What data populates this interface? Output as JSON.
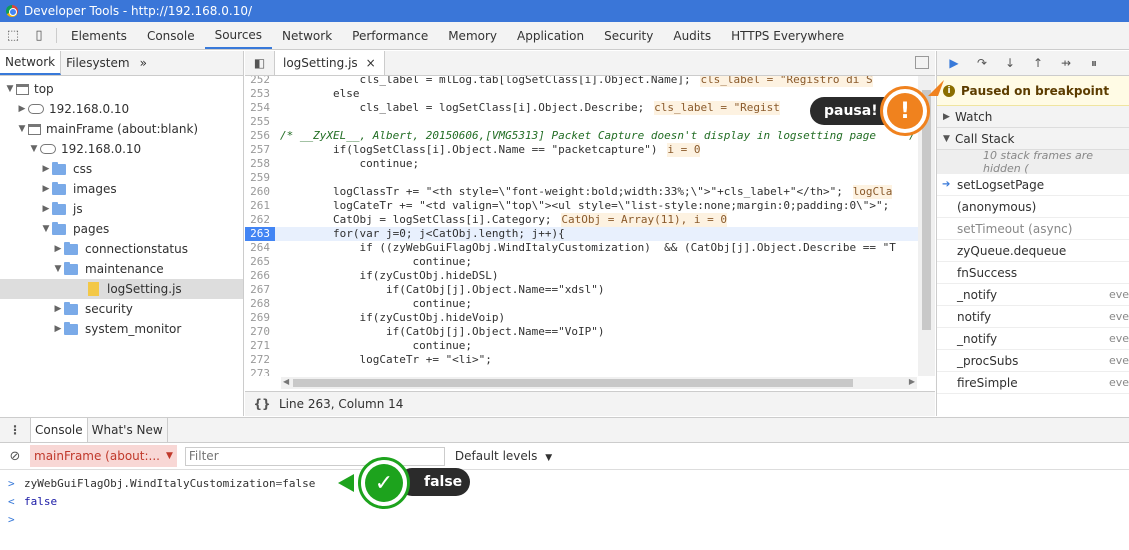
{
  "window": {
    "title": "Developer Tools - http://192.168.0.10/"
  },
  "tabs": [
    "Elements",
    "Console",
    "Sources",
    "Network",
    "Performance",
    "Memory",
    "Application",
    "Security",
    "Audits",
    "HTTPS Everywhere"
  ],
  "active_tab": "Sources",
  "navigator": {
    "subtabs": [
      "Network",
      "Filesystem"
    ],
    "more": "»",
    "tree": [
      {
        "label": "top"
      },
      {
        "label": "192.168.0.10"
      },
      {
        "label": "mainFrame (about:blank)"
      },
      {
        "label": "192.168.0.10"
      },
      {
        "label": "css"
      },
      {
        "label": "images"
      },
      {
        "label": "js"
      },
      {
        "label": "pages"
      },
      {
        "label": "connectionstatus"
      },
      {
        "label": "maintenance"
      },
      {
        "label": "logSetting.js"
      },
      {
        "label": "security"
      },
      {
        "label": "system_monitor"
      }
    ]
  },
  "editor": {
    "file_tab": "logSetting.js",
    "close": "×",
    "status": "Line 263, Column 14",
    "braces": "{}",
    "lines": [
      {
        "n": "252",
        "t": "            cls_label = mlLog.tab[logSetClass[i].Object.Name];",
        "inl": "cls_label = \"Registro di S"
      },
      {
        "n": "253",
        "t": "        else",
        "inl": ""
      },
      {
        "n": "254",
        "t": "            cls_label = logSetClass[i].Object.Describe;",
        "inl": "cls_label = \"Regist"
      },
      {
        "n": "255",
        "t": "",
        "inl": ""
      },
      {
        "n": "256",
        "t": "/* __ZyXEL__, Albert, 20150606,[VMG5313] Packet Capture doesn't display in logsetting page    */",
        "inl": ""
      },
      {
        "n": "257",
        "t": "        if(logSetClass[i].Object.Name == \"packetcapture\")",
        "inl": "i = 0"
      },
      {
        "n": "258",
        "t": "            continue;",
        "inl": ""
      },
      {
        "n": "259",
        "t": "",
        "inl": ""
      },
      {
        "n": "260",
        "t": "        logClassTr += \"<th style=\\\"font-weight:bold;width:33%;\\\">\"+cls_label+\"</th>\";",
        "inl": "logCla"
      },
      {
        "n": "261",
        "t": "        logCateTr += \"<td valign=\\\"top\\\"><ul style=\\\"list-style:none;margin:0;padding:0\\\">\";",
        "inl": ""
      },
      {
        "n": "262",
        "t": "        CatObj = logSetClass[i].Category;",
        "inl": "CatObj = Array(11), i = 0"
      },
      {
        "n": "263",
        "t": "        for(var j=0; j<CatObj.length; j++){",
        "inl": ""
      },
      {
        "n": "264",
        "t": "            if ((zyWebGuiFlagObj.WindItalyCustomization)  && (CatObj[j].Object.Describe == \"T",
        "inl": ""
      },
      {
        "n": "265",
        "t": "                    continue;",
        "inl": ""
      },
      {
        "n": "266",
        "t": "            if(zyCustObj.hideDSL)",
        "inl": ""
      },
      {
        "n": "267",
        "t": "                if(CatObj[j].Object.Name==\"xdsl\")",
        "inl": ""
      },
      {
        "n": "268",
        "t": "                    continue;",
        "inl": ""
      },
      {
        "n": "269",
        "t": "            if(zyCustObj.hideVoip)",
        "inl": ""
      },
      {
        "n": "270",
        "t": "                if(CatObj[j].Object.Name==\"VoIP\")",
        "inl": ""
      },
      {
        "n": "271",
        "t": "                    continue;",
        "inl": ""
      },
      {
        "n": "272",
        "t": "            logCateTr += \"<li>\";",
        "inl": ""
      },
      {
        "n": "273",
        "t": "",
        "inl": ""
      }
    ]
  },
  "debugger": {
    "paused": "Paused on breakpoint",
    "watch": "Watch",
    "callstack": "Call Stack",
    "hidden": "10 stack frames are hidden (",
    "frames": [
      {
        "name": "setLogsetPage",
        "loc": "",
        "current": true,
        "async": false
      },
      {
        "name": "(anonymous)",
        "loc": "",
        "current": false,
        "async": false
      },
      {
        "name": "setTimeout (async)",
        "loc": "",
        "current": false,
        "async": true
      },
      {
        "name": "zyQueue.dequeue",
        "loc": "",
        "current": false,
        "async": false
      },
      {
        "name": "fnSuccess",
        "loc": "",
        "current": false,
        "async": false
      },
      {
        "name": "_notify",
        "loc": "eve",
        "current": false,
        "async": false
      },
      {
        "name": "notify",
        "loc": "eve",
        "current": false,
        "async": false
      },
      {
        "name": "_notify",
        "loc": "eve",
        "current": false,
        "async": false
      },
      {
        "name": "_procSubs",
        "loc": "eve",
        "current": false,
        "async": false
      },
      {
        "name": "fireSimple",
        "loc": "eve",
        "current": false,
        "async": false
      }
    ]
  },
  "console": {
    "tabs": [
      "Console",
      "What's New"
    ],
    "context": "mainFrame (about:...",
    "filter_placeholder": "Filter",
    "levels": "Default levels",
    "input_expr": "zyWebGuiFlagObj.WindItalyCustomization",
    "input_op": " = ",
    "input_val": "false",
    "result": "false",
    "prompt": ">",
    "result_mark": "<"
  },
  "callouts": {
    "pause": "pausa!",
    "pause_mark": "!",
    "result": "false",
    "result_mark": "✓"
  },
  "colors": {
    "accent": "#3879d9",
    "callout_orange": "#f0821e",
    "callout_green": "#1da31d"
  }
}
